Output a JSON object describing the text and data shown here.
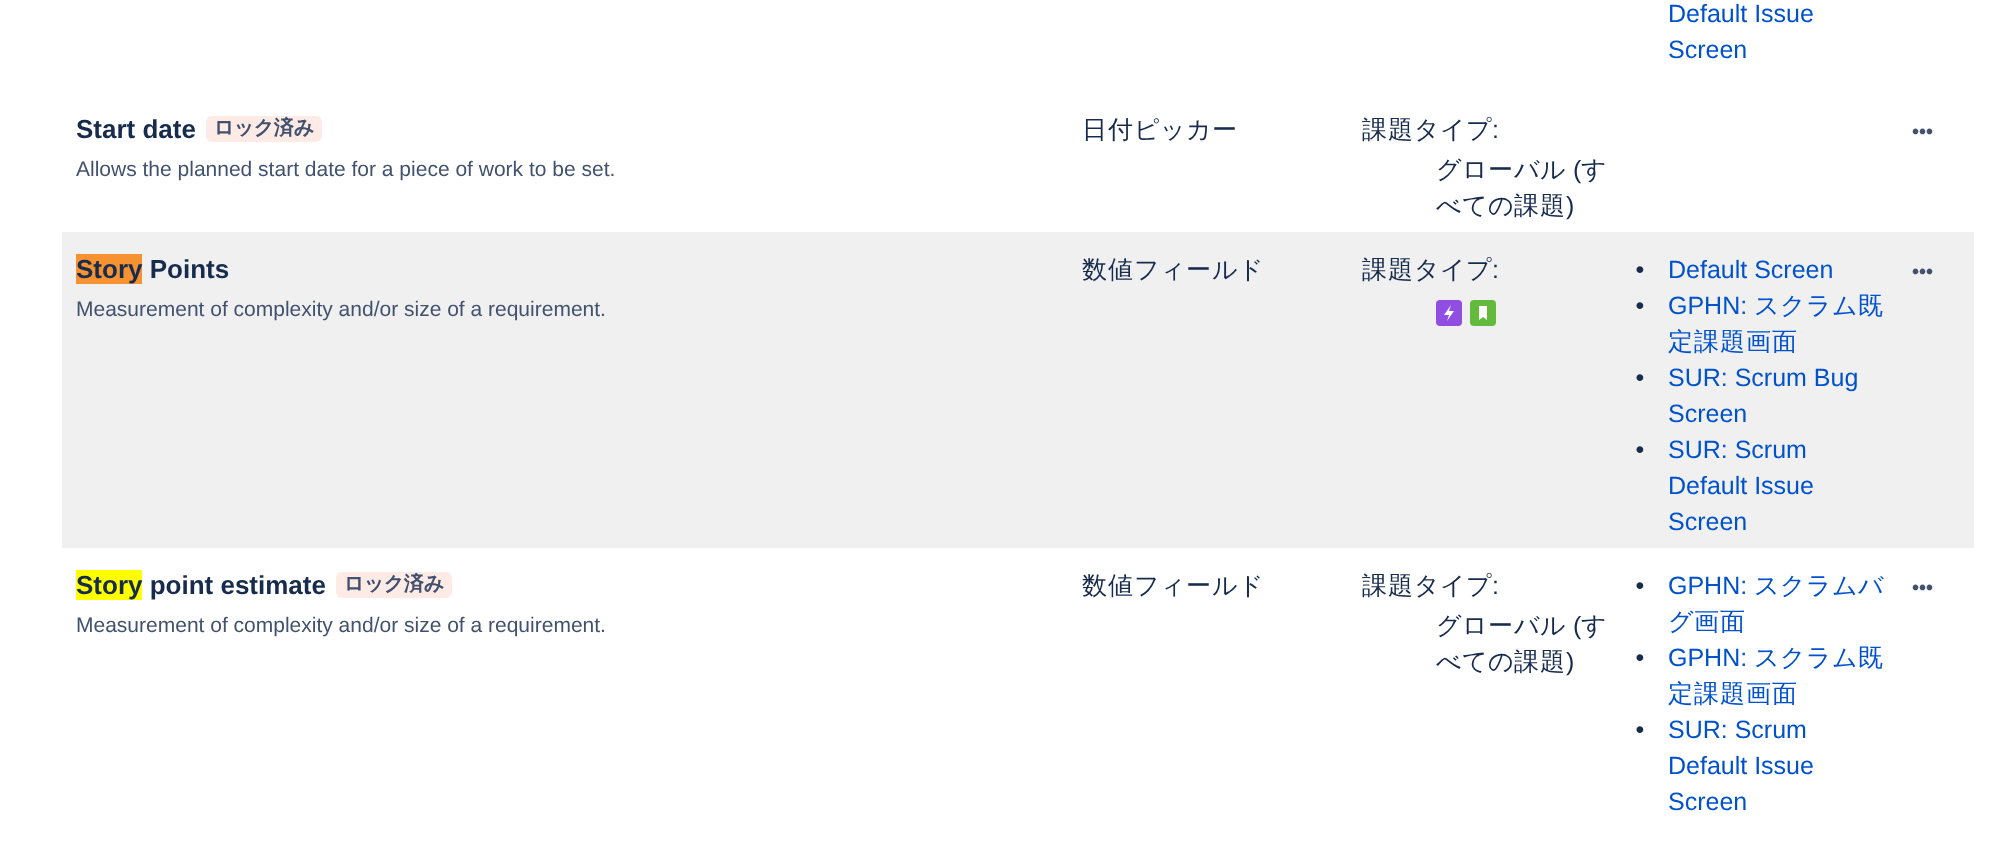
{
  "rows": [
    {
      "kind": "continuation",
      "screens": [
        {
          "label": "Default Issue Screen"
        }
      ]
    },
    {
      "kind": "field",
      "name": [
        {
          "text": "Start date",
          "kind": "plain"
        }
      ],
      "locked": true,
      "lock_label": "ロック済み",
      "description": "Allows the planned start date for a piece of work to be set.",
      "type": "日付ピッカー",
      "context_label": "課題タイプ:",
      "context": {
        "kind": "text",
        "value": "グローバル (すべての課題)"
      },
      "screens": [],
      "menu": "•••",
      "selected": false
    },
    {
      "kind": "field",
      "name": [
        {
          "text": "Story",
          "kind": "match",
          "current": true
        },
        {
          "text": " Points",
          "kind": "plain"
        }
      ],
      "locked": false,
      "description": "Measurement of complexity and/or size of a requirement.",
      "type": "数値フィールド",
      "context_label": "課題タイプ:",
      "context": {
        "kind": "icons",
        "icons": [
          {
            "kind": "bolt",
            "color": "#904ee2"
          },
          {
            "kind": "bookmark",
            "color": "#63ba3c"
          }
        ]
      },
      "screens": [
        {
          "bullet": "•",
          "label": "Default Screen"
        },
        {
          "bullet": "•",
          "label": "GPHN: スクラム既定課題画面"
        },
        {
          "bullet": "•",
          "label": "SUR: Scrum Bug Screen"
        },
        {
          "bullet": "•",
          "label": "SUR: Scrum Default Issue Screen"
        }
      ],
      "menu": "•••",
      "selected": true
    },
    {
      "kind": "field",
      "name": [
        {
          "text": "Story",
          "kind": "match",
          "current": false
        },
        {
          "text": " point estimate",
          "kind": "plain"
        }
      ],
      "locked": true,
      "lock_label": "ロック済み",
      "description": "Measurement of complexity and/or size of a requirement.",
      "type": "数値フィールド",
      "context_label": "課題タイプ:",
      "context": {
        "kind": "text",
        "value": "グローバル (すべての課題)"
      },
      "screens": [
        {
          "bullet": "•",
          "label": "GPHN: スクラムバグ画面"
        },
        {
          "bullet": "•",
          "label": "GPHN: スクラム既定課題画面"
        },
        {
          "bullet": "•",
          "label": "SUR: Scrum Default Issue Screen"
        }
      ],
      "menu": "•••",
      "selected": false
    }
  ]
}
